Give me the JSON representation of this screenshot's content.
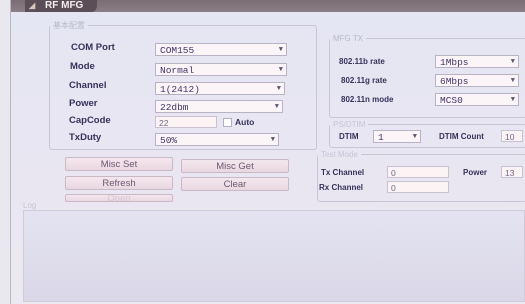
{
  "window": {
    "title": "RF MFG"
  },
  "basic_settings": {
    "group_title": "基本配置",
    "com_port": {
      "label": "COM Port",
      "value": "COM155"
    },
    "mode": {
      "label": "Mode",
      "value": "Normal"
    },
    "channel": {
      "label": "Channel",
      "value": "1(2412)"
    },
    "power": {
      "label": "Power",
      "value": "22dbm"
    },
    "capcode": {
      "label": "CapCode",
      "value": "22",
      "auto_label": "Auto"
    },
    "txduty": {
      "label": "TxDuty",
      "value": "50%"
    }
  },
  "mfg_tx": {
    "group_title": "MFG TX",
    "rate_11b": {
      "label": "802.11b rate",
      "value": "1Mbps"
    },
    "rate_11g": {
      "label": "802.11g rate",
      "value": "6Mbps"
    },
    "mode_11n": {
      "label": "802.11n mode",
      "value": "MCS0"
    }
  },
  "dtim_group": {
    "group_title": "PS/DTIM",
    "dtim": {
      "label": "DTIM",
      "value": "1"
    },
    "dtim_count": {
      "label": "DTIM Count",
      "value": "10"
    }
  },
  "test_mode": {
    "group_title": "Test Mode",
    "tx_channel": {
      "label": "Tx Channel",
      "value": "0"
    },
    "power": {
      "label": "Power",
      "value": "13"
    },
    "rx_channel": {
      "label": "Rx Channel",
      "value": "0"
    }
  },
  "buttons": {
    "misc_set": "Misc Set",
    "misc_get": "Misc Get",
    "refresh": "Refresh",
    "clear": "Clear",
    "open": "Open"
  },
  "log": {
    "label": "Log"
  },
  "colors": {
    "title_bar": "#7a6d74",
    "label_text": "#35325a",
    "accent": "#5c4e56"
  }
}
